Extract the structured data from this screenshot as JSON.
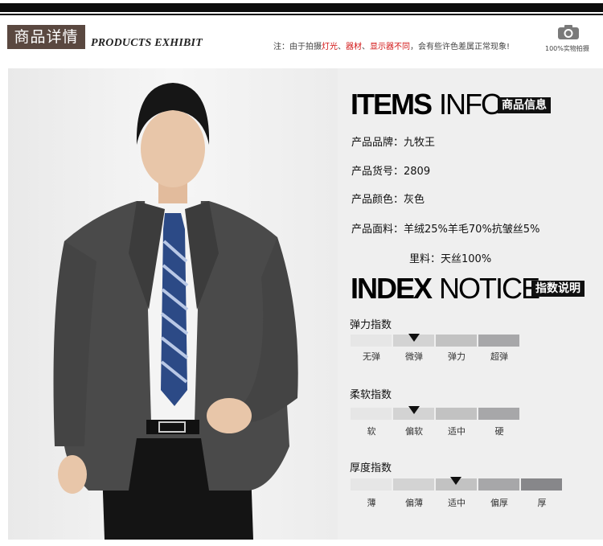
{
  "header": {
    "title_cn": "商品详情",
    "title_en": "PRODUCTS EXHIBIT",
    "note_prefix": "注：由于拍摄",
    "note_red1": "灯光",
    "note_sep1": "、",
    "note_red2": "器材",
    "note_sep2": "、",
    "note_red3": "显示器不同",
    "note_suffix": "，会有些许色差属正常现象!",
    "camera_label": "100%实物拍摄"
  },
  "items_info": {
    "heading_bold": "ITEMS",
    "heading_light": "INFO",
    "badge": "商品信息",
    "rows": [
      {
        "label": "产品品牌：",
        "value": "九牧王"
      },
      {
        "label": "产品货号：",
        "value": "2809"
      },
      {
        "label": "产品颜色：",
        "value": "灰色"
      },
      {
        "label": "产品面料：",
        "value": "羊绒25%羊毛70%抗皱丝5%"
      },
      {
        "label": "",
        "value": "里料：天丝100%"
      }
    ]
  },
  "index_notice": {
    "heading_bold": "INDEX",
    "heading_light": "NOTICE",
    "badge": "指数说明",
    "scales": [
      {
        "title": "弹力指数",
        "labels": [
          "无弹",
          "微弹",
          "弹力",
          "超弹"
        ],
        "selected_index": 1
      },
      {
        "title": "柔软指数",
        "labels": [
          "软",
          "偏软",
          "适中",
          "硬"
        ],
        "selected_index": 1
      },
      {
        "title": "厚度指数",
        "labels": [
          "薄",
          "偏薄",
          "适中",
          "偏厚",
          "厚"
        ],
        "selected_index": 2
      }
    ]
  },
  "colors": {
    "title_box": "#5a4840",
    "note_red": "#d21515",
    "panel_bg": "#efefef",
    "segment_shades": [
      "#e6e6e6",
      "#d3d3d3",
      "#c2c2c2",
      "#a7a7a9",
      "#87878a"
    ]
  }
}
